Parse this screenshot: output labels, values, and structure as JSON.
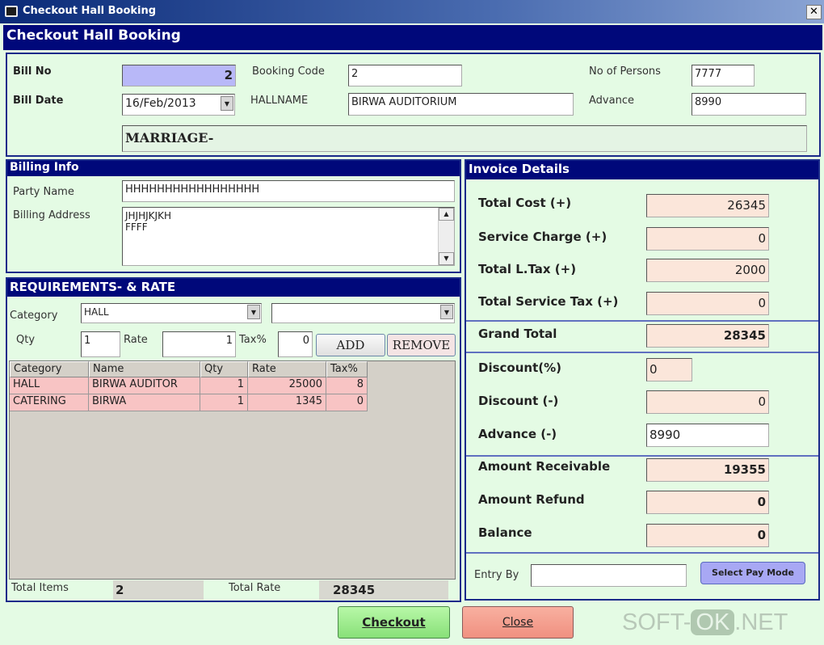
{
  "window": {
    "title": "Checkout Hall Booking",
    "close": "✕"
  },
  "header": {
    "title": "Checkout Hall Booking"
  },
  "top": {
    "bill_no_label": "Bill No",
    "bill_no": "2",
    "booking_code_label": "Booking Code",
    "booking_code": "2",
    "persons_label": "No of Persons",
    "persons": "7777",
    "bill_date_label": "Bill Date",
    "bill_date": "16/Feb/2013",
    "hallname_label": "HALLNAME",
    "hallname": "BIRWA AUDITORIUM",
    "advance_label": "Advance",
    "advance": "8990",
    "event": "MARRIAGE-"
  },
  "billing": {
    "title": "Billing Info",
    "party_label": "Party Name",
    "party": "HHHHHHHHHHHHHHHHH",
    "address_label": "Billing Address",
    "address_line1": "JHJHJKJKH",
    "address_line2": "FFFF"
  },
  "requirements": {
    "title": "REQUIREMENTS- & RATE",
    "category_label": "Category",
    "category": "HALL",
    "subcategory": "",
    "qty_label": "Qty",
    "qty": "1",
    "rate_label": "Rate",
    "rate": "1",
    "tax_label": "Tax%",
    "tax": "0",
    "add": "ADD",
    "remove": "REMOVE",
    "columns": [
      "Category",
      "Name",
      "Qty",
      "Rate",
      "Tax%"
    ],
    "rows": [
      [
        "HALL",
        "BIRWA AUDITOR",
        "1",
        "25000",
        "8"
      ],
      [
        "CATERING",
        "BIRWA",
        "1",
        "1345",
        "0"
      ]
    ],
    "total_items_label": "Total  Items",
    "total_items": "2",
    "total_rate_label": "Total Rate",
    "total_rate": "28345"
  },
  "invoice": {
    "title": "Invoice Details",
    "total_cost_label": "Total Cost (+)",
    "total_cost": "26345",
    "service_charge_label": "Service Charge (+)",
    "service_charge": "0",
    "ltax_label": "Total L.Tax (+)",
    "ltax": "2000",
    "stax_label": "Total Service Tax (+)",
    "stax": "0",
    "grand_total_label": "Grand Total",
    "grand_total": "28345",
    "discount_pct_label": "Discount(%)",
    "discount_pct": "0",
    "discount_label": "Discount (-)",
    "discount": "0",
    "advance_label": "Advance (-)",
    "advance": "8990",
    "receivable_label": "Amount Receivable",
    "receivable": "19355",
    "refund_label": "Amount Refund",
    "refund": "0",
    "balance_label": "Balance",
    "balance": "0",
    "entry_by_label": "Entry By",
    "entry_by": "",
    "pay_mode": "Select Pay Mode"
  },
  "footer": {
    "checkout": "Checkout",
    "close": "Close"
  },
  "watermark": {
    "left": "SOFT-",
    "mid": "OK",
    "right": ".NET"
  }
}
